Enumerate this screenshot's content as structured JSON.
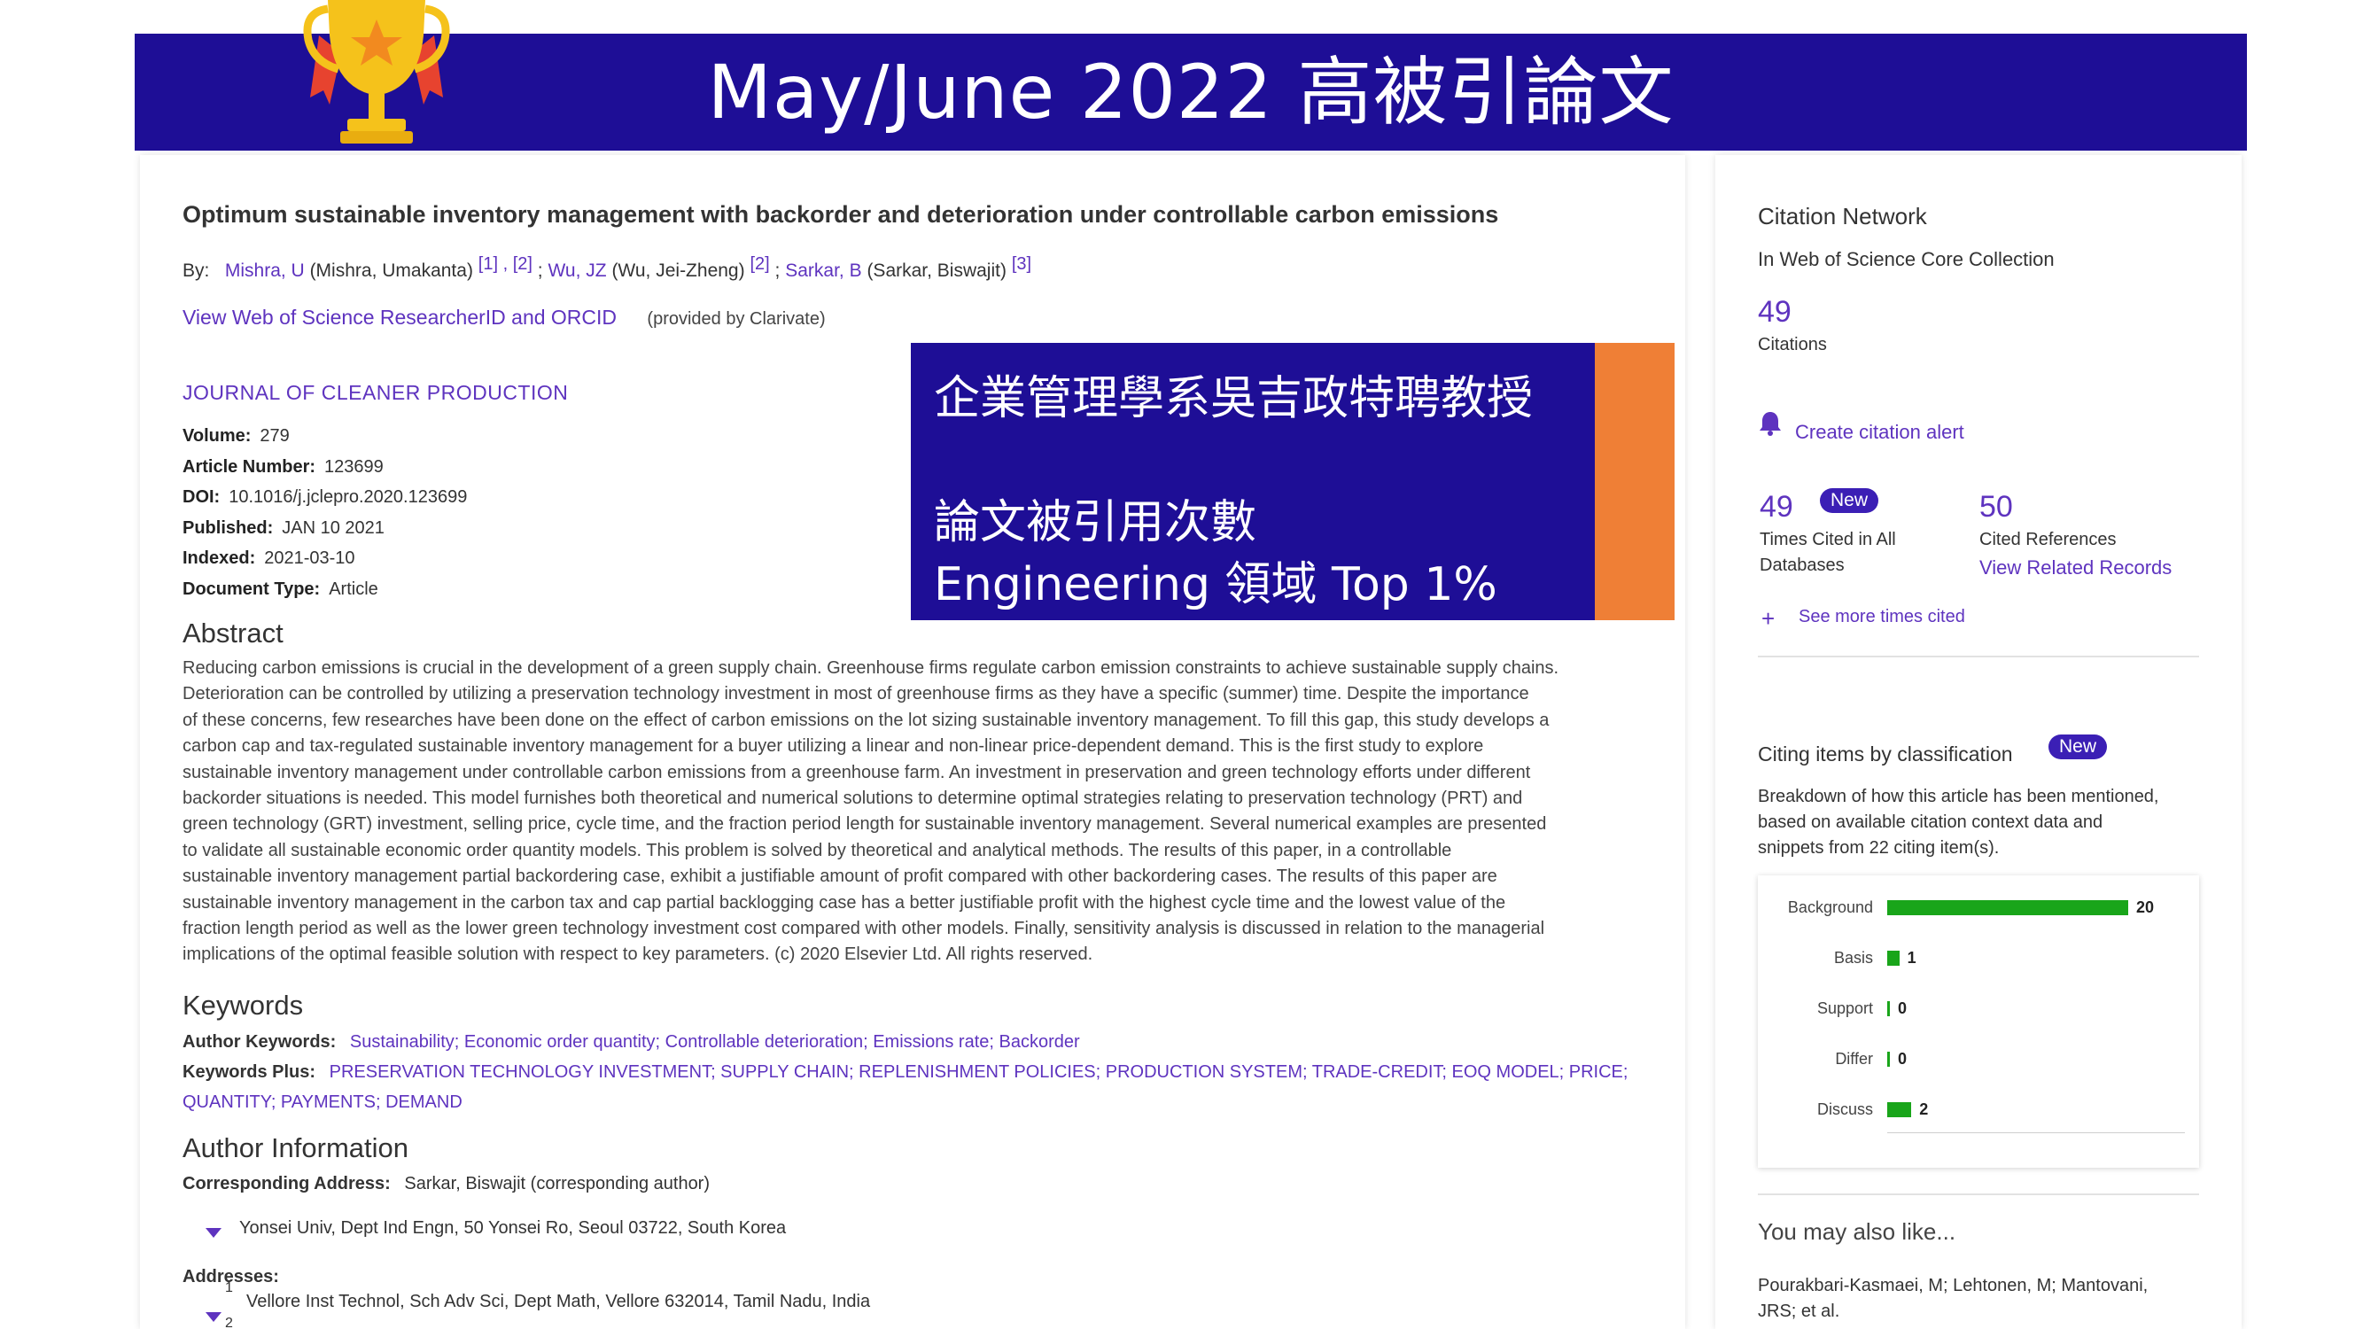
{
  "banner": {
    "title": "May/June 2022 高被引論文"
  },
  "article": {
    "title": "Optimum sustainable inventory management with backorder and deterioration under controllable carbon emissions",
    "by_label": "By:",
    "authors": [
      {
        "short": "Mishra, U",
        "full": "(Mishra, Umakanta)",
        "refs": "[1] , [2]"
      },
      {
        "short": "Wu, JZ",
        "full": "(Wu, Jei-Zheng)",
        "refs": "[2]"
      },
      {
        "short": "Sarkar, B",
        "full": "(Sarkar, Biswajit)",
        "refs": "[3]"
      }
    ],
    "researcher_link": "View Web of Science ResearcherID and ORCID",
    "provided_by": "(provided by Clarivate)",
    "journal": "JOURNAL OF CLEANER PRODUCTION",
    "meta": [
      {
        "label": "Volume:",
        "value": "279"
      },
      {
        "label": "Article Number:",
        "value": "123699"
      },
      {
        "label": "DOI:",
        "value": "10.1016/j.jclepro.2020.123699"
      },
      {
        "label": "Published:",
        "value": "JAN 10 2021"
      },
      {
        "label": "Indexed:",
        "value": "2021-03-10"
      },
      {
        "label": "Document Type:",
        "value": "Article"
      }
    ],
    "abstract_heading": "Abstract",
    "abstract_lines": [
      "Reducing carbon emissions is crucial in the development of a green supply chain. Greenhouse firms regulate carbon emission constraints to achieve sustainable supply chains.",
      "Deterioration can be controlled by utilizing a preservation technology investment in most of greenhouse firms as they have a specific (summer) time. Despite the importance",
      "of these concerns, few researches have been done on the effect of carbon emissions on the lot sizing sustainable inventory management. To fill this gap, this study develops a",
      "carbon cap and tax-regulated sustainable inventory management for a buyer utilizing a linear and non-linear price-dependent demand. This is the first study to explore",
      "sustainable inventory management under controllable carbon emissions from a greenhouse farm. An investment in preservation and green technology efforts under different",
      "backorder situations is needed. This model furnishes both theoretical and numerical solutions to determine optimal strategies relating to preservation technology (PRT) and",
      "green technology (GRT) investment, selling price, cycle time, and the fraction period length for sustainable inventory management. Several numerical examples are presented",
      "to validate all sustainable economic order quantity models. This problem is solved by theoretical and analytical methods. The results of this paper, in a controllable",
      "sustainable inventory management partial backordering case, exhibit a justifiable amount of profit compared with other backordering cases. The results of this paper are",
      "sustainable inventory management in the carbon tax and cap partial backlogging case has a better justifiable profit with the highest cycle time and the lowest value of the",
      "fraction length period as well as the lower green technology investment cost compared with other models. Finally, sensitivity analysis is discussed in relation to the managerial",
      "implications of the optimal feasible solution with respect to key parameters. (c) 2020 Elsevier Ltd. All rights reserved."
    ],
    "keywords_heading": "Keywords",
    "author_keywords_label": "Author Keywords:",
    "author_keywords": "Sustainability; Economic order quantity; Controllable deterioration; Emissions rate; Backorder",
    "keywords_plus_label": "Keywords Plus:",
    "keywords_plus_line1": "PRESERVATION TECHNOLOGY INVESTMENT; SUPPLY CHAIN; REPLENISHMENT POLICIES; PRODUCTION SYSTEM; TRADE-CREDIT; EOQ MODEL; PRICE;",
    "keywords_plus_line2": "QUANTITY; PAYMENTS; DEMAND",
    "author_info_heading": "Author Information",
    "corresponding_label": "Corresponding Address:",
    "corresponding_value": "Sarkar, Biswajit  (corresponding author)",
    "corresponding_address": "Yonsei Univ, Dept Ind Engn, 50 Yonsei Ro, Seoul 03722, South Korea",
    "addresses_label": "Addresses:",
    "address_1_num": "1",
    "address_1": "Vellore Inst Technol, Sch Adv Sci, Dept Math, Vellore 632014, Tamil Nadu, India",
    "address_2_num": "2"
  },
  "overlay": {
    "line1": "企業管理學系吳吉政特聘教授",
    "line2": "論文被引用次數",
    "line3": "Engineering 領域 Top 1%"
  },
  "sidebar": {
    "citation_network": "Citation Network",
    "collection": "In Web of Science Core Collection",
    "citations_count": "49",
    "citations_label": "Citations",
    "create_alert": "Create citation alert",
    "times_cited_count": "49",
    "new_badge": "New",
    "times_cited_label_1": "Times Cited in All",
    "times_cited_label_2": "Databases",
    "cited_refs_count": "50",
    "cited_refs_label": "Cited References",
    "view_related": "View Related Records",
    "see_more": "See more times cited",
    "citing_heading": "Citing items by classification",
    "citing_new_badge": "New",
    "breakdown_1": "Breakdown of how this article has been mentioned,",
    "breakdown_2": "based on available citation context data and",
    "breakdown_3": "snippets from 22 citing item(s).",
    "you_may_like": "You may also like...",
    "like_item_1": "Pourakbari-Kasmaei, M; Lehtonen, M; Mantovani,",
    "like_item_2": "JRS; et al.",
    "plus_sign": "+"
  },
  "chart_data": {
    "type": "bar",
    "orientation": "horizontal",
    "categories": [
      "Background",
      "Basis",
      "Support",
      "Differ",
      "Discuss"
    ],
    "values": [
      20,
      1,
      0,
      0,
      2
    ],
    "xlim": [
      0,
      20
    ],
    "color": "#19a51a",
    "grid": false,
    "legend": "none"
  }
}
